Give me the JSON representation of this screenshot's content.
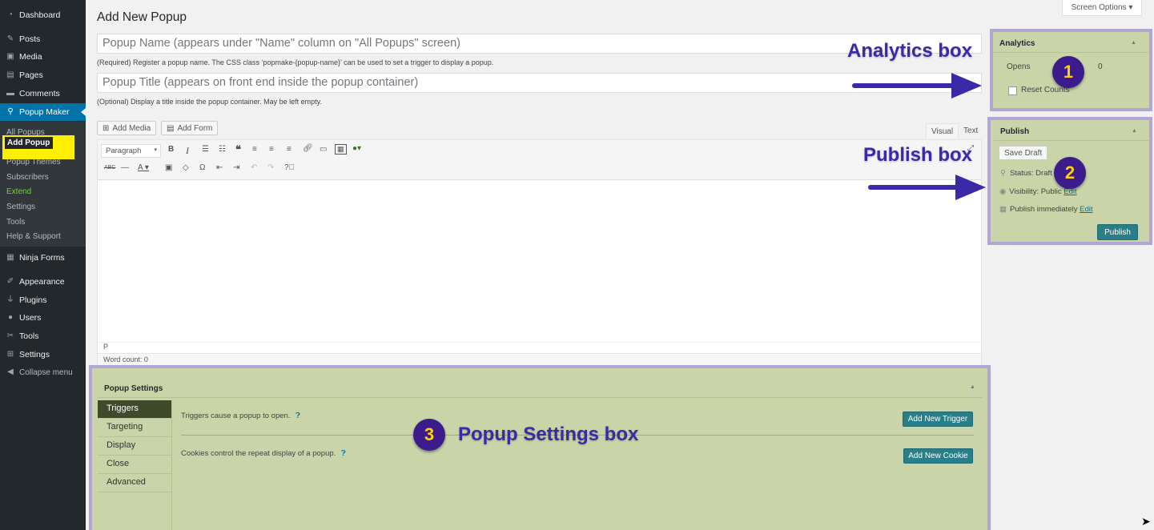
{
  "menu": {
    "items": [
      {
        "label": "Dashboard",
        "icon": "dashboard-icon"
      },
      {
        "label": "Posts",
        "icon": "pin-icon"
      },
      {
        "label": "Media",
        "icon": "media-icon"
      },
      {
        "label": "Pages",
        "icon": "pages-icon"
      },
      {
        "label": "Comments",
        "icon": "comments-icon"
      },
      {
        "label": "Popup Maker",
        "icon": "popup-maker-icon"
      },
      {
        "label": "Ninja Forms",
        "icon": "ninja-forms-icon"
      },
      {
        "label": "Appearance",
        "icon": "brush-icon"
      },
      {
        "label": "Plugins",
        "icon": "plugin-icon"
      },
      {
        "label": "Users",
        "icon": "users-icon"
      },
      {
        "label": "Tools",
        "icon": "wrench-icon"
      },
      {
        "label": "Settings",
        "icon": "settings-icon"
      },
      {
        "label": "Collapse menu",
        "icon": "collapse-icon"
      }
    ],
    "submenu": [
      "All Popups",
      "Add Popup",
      "Popup Themes",
      "Subscribers",
      "Extend",
      "Settings",
      "Tools",
      "Help & Support"
    ]
  },
  "screen_options": "Screen Options ▾",
  "page_title": "Add New Popup",
  "name_field": {
    "placeholder": "Popup Name (appears under \"Name\" column on \"All Popups\" screen)",
    "help": "(Required) Register a popup name. The CSS class ‘popmake-{popup-name}’ can be used to set a trigger to display a popup."
  },
  "title_field": {
    "placeholder": "Popup Title (appears on front end inside the popup container)",
    "help": "(Optional) Display a title inside the popup container. May be left empty."
  },
  "editor": {
    "add_media": "Add Media",
    "add_form": "Add Form",
    "tab_visual": "Visual",
    "tab_text": "Text",
    "format_select": "Paragraph",
    "path": "P",
    "word_count": "Word count: 0"
  },
  "analytics": {
    "title": "Analytics",
    "opens_label": "Opens",
    "opens_value": "0",
    "reset_label": "Reset Counts"
  },
  "publish": {
    "title": "Publish",
    "save_draft": "Save Draft",
    "status_label": "Status: Draft",
    "visibility_label": "Visibility: Public",
    "visibility_edit": "Edit",
    "schedule_label": "Publish immediately",
    "schedule_edit": "Edit",
    "publish_button": "Publish"
  },
  "popup_settings": {
    "title": "Popup Settings",
    "tabs": [
      "Triggers",
      "Targeting",
      "Display",
      "Close",
      "Advanced"
    ],
    "triggers_text": "Triggers cause a popup to open.",
    "add_trigger": "Add New Trigger",
    "cookies_text": "Cookies control the repeat display of a popup.",
    "add_cookie": "Add New Cookie"
  },
  "annotations": {
    "analytics": "Analytics box",
    "publish": "Publish box",
    "settings": "Popup Settings box",
    "n1": "1",
    "n2": "2",
    "n3": "3"
  },
  "colors": {
    "menu_bg": "#23282d",
    "accent": "#0073aa",
    "highlight": "#ffef00",
    "annotation": "#3b2aa8",
    "box_bg": "#c9d4a8"
  }
}
